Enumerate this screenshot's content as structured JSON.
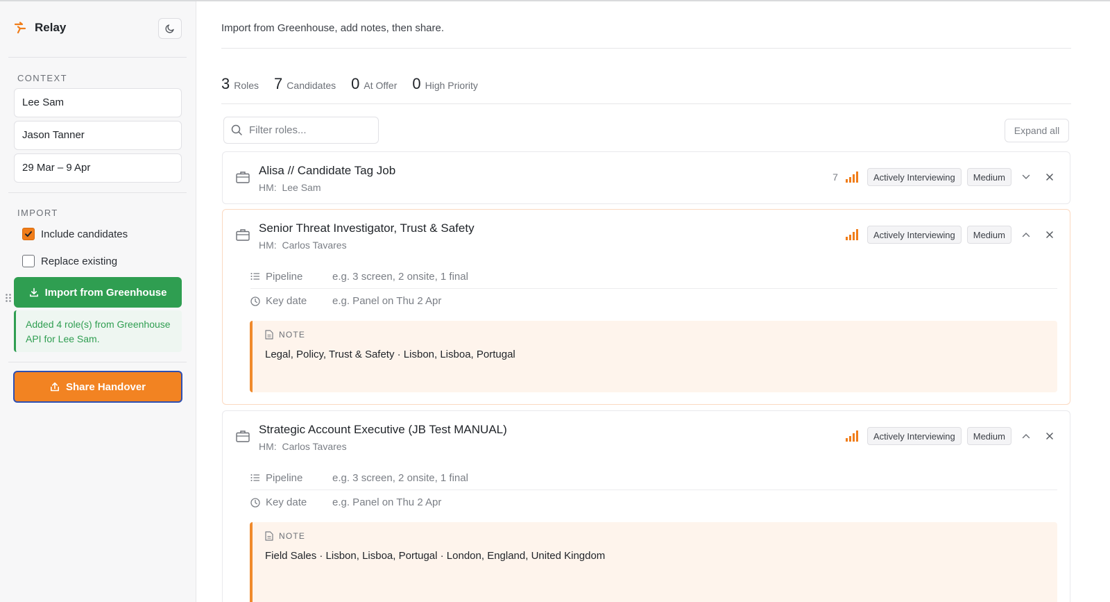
{
  "app": {
    "name": "Relay"
  },
  "sidebar": {
    "context_label": "CONTEXT",
    "context_fields": [
      "Lee Sam",
      "Jason Tanner",
      "29 Mar – 9 Apr"
    ],
    "import_label": "IMPORT",
    "include_candidates": {
      "label": "Include candidates",
      "checked": true
    },
    "replace_existing": {
      "label": "Replace existing",
      "checked": false
    },
    "import_button": "Import from Greenhouse",
    "import_notice": "Added 4 role(s) from Greenhouse API for Lee Sam.",
    "share_button": "Share Handover"
  },
  "main": {
    "subtitle": "Import from Greenhouse, add notes, then share.",
    "stats": [
      {
        "value": "3",
        "label": "Roles"
      },
      {
        "value": "7",
        "label": "Candidates"
      },
      {
        "value": "0",
        "label": "At Offer"
      },
      {
        "value": "0",
        "label": "High Priority"
      }
    ],
    "filter_placeholder": "Filter roles...",
    "expand_all": "Expand all",
    "roles": [
      {
        "title": "Alisa // Candidate Tag Job",
        "hm_prefix": "HM:",
        "hm": "Lee Sam",
        "count": "7",
        "status": "Actively Interviewing",
        "priority": "Medium",
        "expanded": false
      },
      {
        "title": "Senior Threat Investigator, Trust & Safety",
        "hm_prefix": "HM:",
        "hm": "Carlos Tavares",
        "status": "Actively Interviewing",
        "priority": "Medium",
        "expanded": true,
        "pipeline_label": "Pipeline",
        "pipeline_placeholder": "e.g. 3 screen, 2 onsite, 1 final",
        "keydate_label": "Key date",
        "keydate_placeholder": "e.g. Panel on Thu 2 Apr",
        "note_label": "NOTE",
        "note": "Legal, Policy, Trust & Safety · Lisbon, Lisboa, Portugal"
      },
      {
        "title": "Strategic Account Executive (JB Test MANUAL)",
        "hm_prefix": "HM:",
        "hm": "Carlos Tavares",
        "status": "Actively Interviewing",
        "priority": "Medium",
        "expanded": true,
        "pipeline_label": "Pipeline",
        "pipeline_placeholder": "e.g. 3 screen, 2 onsite, 1 final",
        "keydate_label": "Key date",
        "keydate_placeholder": "e.g. Panel on Thu 2 Apr",
        "note_label": "NOTE",
        "note": "Field Sales · Lisbon, Lisboa, Portugal · London, England, United Kingdom"
      }
    ]
  },
  "colors": {
    "accent_orange": "#f28322",
    "success_green": "#2f9e51",
    "focus_blue": "#2d4fb3",
    "note_bg": "#fef4ec"
  }
}
